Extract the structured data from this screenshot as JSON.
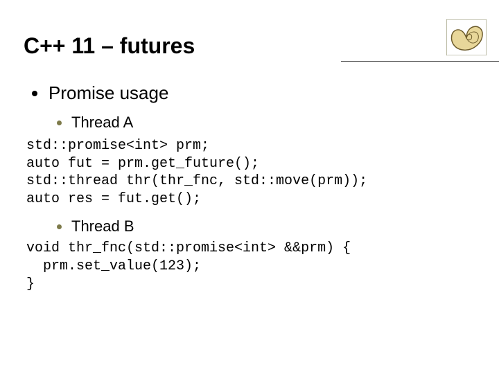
{
  "title": "C++ 11 – futures",
  "bullets": {
    "l1": "Promise usage",
    "l2a": "Thread A",
    "l2b": "Thread B"
  },
  "code": {
    "blockA": "std::promise<int> prm;\nauto fut = prm.get_future();\nstd::thread thr(thr_fnc, std::move(prm));\nauto res = fut.get();",
    "blockB": "void thr_fnc(std::promise<int> &&prm) {\n  prm.set_value(123);\n}"
  }
}
